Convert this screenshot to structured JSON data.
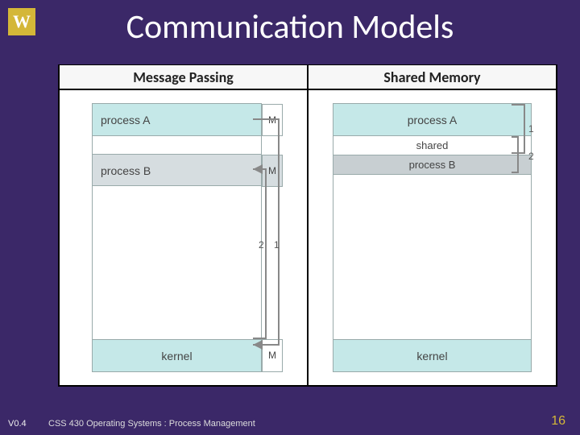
{
  "logo_letter": "W",
  "title": "Communication Models",
  "headers": {
    "left": "Message Passing",
    "right": "Shared Memory"
  },
  "mp": {
    "procA": "process A",
    "procB": "process B",
    "kernel": "kernel",
    "M": "M",
    "lbl1": "1",
    "lbl2": "2"
  },
  "sm": {
    "procA": "process A",
    "shared": "shared",
    "procB": "process B",
    "kernel": "kernel",
    "lbl1": "1",
    "lbl2": "2"
  },
  "footer": "CSS 430 Operating Systems : Process Management",
  "version": "V0.4",
  "page": "16"
}
